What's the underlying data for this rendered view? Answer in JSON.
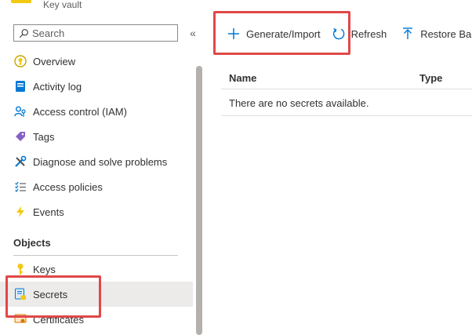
{
  "header": {
    "resource_type": "Key vault",
    "vault_icon": "key-vault-icon"
  },
  "search": {
    "placeholder": "Search",
    "icon": "search-icon"
  },
  "collapse": {
    "label": "«"
  },
  "sidebar": {
    "items": [
      {
        "label": "Overview",
        "icon": "overview-icon"
      },
      {
        "label": "Activity log",
        "icon": "activity-log-icon"
      },
      {
        "label": "Access control (IAM)",
        "icon": "access-control-icon"
      },
      {
        "label": "Tags",
        "icon": "tag-icon"
      },
      {
        "label": "Diagnose and solve problems",
        "icon": "wrench-icon"
      },
      {
        "label": "Access policies",
        "icon": "access-policies-icon"
      },
      {
        "label": "Events",
        "icon": "lightning-icon"
      }
    ],
    "section_title": "Objects",
    "object_items": [
      {
        "label": "Keys",
        "icon": "key-icon"
      },
      {
        "label": "Secrets",
        "icon": "secret-icon",
        "selected": true
      },
      {
        "label": "Certificates",
        "icon": "certificate-icon"
      }
    ]
  },
  "toolbar": {
    "generate_label": "Generate/Import",
    "refresh_label": "Refresh",
    "restore_label": "Restore Backup"
  },
  "table": {
    "columns": [
      "Name",
      "Type"
    ],
    "empty_message": "There are no secrets available."
  },
  "colors": {
    "highlight": "#e04848",
    "accent": "#0078d4",
    "selected_bg": "#edebe9"
  }
}
